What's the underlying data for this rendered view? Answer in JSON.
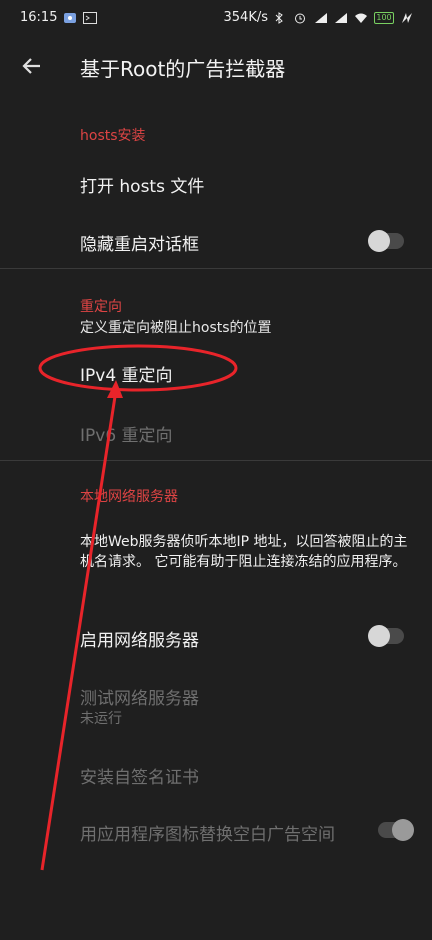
{
  "status_bar": {
    "time": "16:15",
    "speed": "354K/s",
    "battery": "100"
  },
  "appbar": {
    "title": "基于Root的广告拦截器"
  },
  "section_hosts": {
    "header": "hosts安装",
    "open_hosts": "打开 hosts 文件",
    "hide_restart": "隐藏重启对话框"
  },
  "section_redirect": {
    "header": "重定向",
    "subtitle": "定义重定向被阻止hosts的位置",
    "ipv4": "IPv4 重定向",
    "ipv6": "IPv6 重定向"
  },
  "section_server": {
    "header": "本地网络服务器",
    "description": "本地Web服务器侦听本地IP 地址，以回答被阻止的主机名请求。 它可能有助于阻止连接冻结的应用程序。",
    "enable": "启用网络服务器",
    "test": "测试网络服务器",
    "test_status": "未运行",
    "install_cert": "安装自签名证书",
    "replace_icons": "用应用程序图标替换空白广告空间"
  },
  "toggles": {
    "hide_restart_dialog": false,
    "enable_web_server": false,
    "replace_icons": true
  },
  "colors": {
    "accent": "#dd4444",
    "background": "#1f1f1f",
    "annotation": "#e8242a"
  }
}
